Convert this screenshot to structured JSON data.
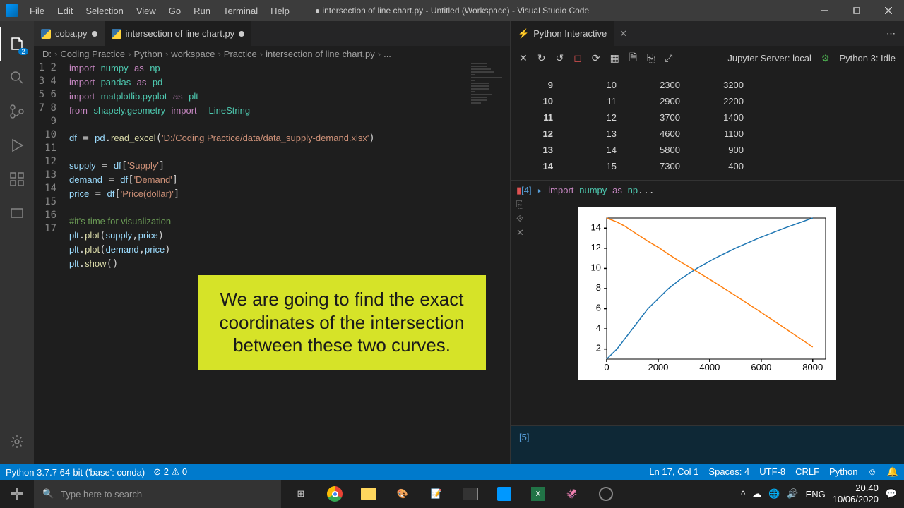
{
  "window": {
    "title": "● intersection of line chart.py - Untitled (Workspace) - Visual Studio Code"
  },
  "menu": [
    "File",
    "Edit",
    "Selection",
    "View",
    "Go",
    "Run",
    "Terminal",
    "Help"
  ],
  "activitybar": {
    "badge": "2"
  },
  "tabs": [
    {
      "label": "coba.py",
      "modified": true
    },
    {
      "label": "intersection of line chart.py",
      "modified": true,
      "active": true
    }
  ],
  "breadcrumb": [
    "D:",
    "Coding Practice",
    "Python",
    "workspace",
    "Practice",
    "intersection of line chart.py",
    "..."
  ],
  "code_lines": [
    "import numpy as np",
    "import pandas as pd",
    "import matplotlib.pyplot as plt",
    "from shapely.geometry import  LineString",
    "",
    "df = pd.read_excel('D:/Coding Practice/data/data_supply-demand.xlsx')",
    "",
    "supply = df['Supply']",
    "demand = df['Demand']",
    "price = df['Price(dollar)']",
    "",
    "#it's time for visualization",
    "plt.plot(supply,price)",
    "plt.plot(demand,price)",
    "plt.show()",
    "",
    ""
  ],
  "annotation": "We are going to find the exact coordinates of the intersection between these two curves.",
  "interactive": {
    "tab_label": "Python Interactive",
    "server_label": "Jupyter Server: local",
    "kernel_label": "Python 3: Idle",
    "data_rows": [
      {
        "idx": "9",
        "c1": "10",
        "c2": "2300",
        "c3": "3200"
      },
      {
        "idx": "10",
        "c1": "11",
        "c2": "2900",
        "c3": "2200"
      },
      {
        "idx": "11",
        "c1": "12",
        "c2": "3700",
        "c3": "1400"
      },
      {
        "idx": "12",
        "c1": "13",
        "c2": "4600",
        "c3": "1100"
      },
      {
        "idx": "13",
        "c1": "14",
        "c2": "5800",
        "c3": "900"
      },
      {
        "idx": "14",
        "c1": "15",
        "c2": "7300",
        "c3": "400"
      }
    ],
    "cell4_prompt": "[4]",
    "cell4_code": "import numpy as np...",
    "cell5_prompt": "[5]"
  },
  "chart_data": {
    "type": "line",
    "x": [
      0,
      400,
      700,
      1000,
      1300,
      1600,
      2000,
      2400,
      2900,
      3500,
      4200,
      5000,
      5900,
      6900,
      8000
    ],
    "series": [
      {
        "name": "supply",
        "color": "#1f77b4",
        "values": [
          1,
          2,
          3,
          4,
          5,
          6,
          7,
          8,
          9,
          10,
          11,
          12,
          13,
          14,
          15
        ]
      },
      {
        "name": "demand",
        "color": "#ff7f0e",
        "values": [
          15,
          14.6,
          14.2,
          13.7,
          13.2,
          12.7,
          12.1,
          11.4,
          10.6,
          9.7,
          8.6,
          7.3,
          5.8,
          4.1,
          2.2
        ]
      }
    ],
    "xlim": [
      0,
      8500
    ],
    "ylim": [
      1,
      15
    ],
    "xticks": [
      0,
      2000,
      4000,
      6000,
      8000
    ],
    "yticks": [
      2,
      4,
      6,
      8,
      10,
      12,
      14
    ]
  },
  "statusbar": {
    "python": "Python 3.7.7 64-bit ('base': conda)",
    "problems_err": "2",
    "problems_warn": "0",
    "cursor": "Ln 17, Col 1",
    "spaces": "Spaces: 4",
    "encoding": "UTF-8",
    "eol": "CRLF",
    "lang": "Python"
  },
  "taskbar": {
    "search_placeholder": "Type here to search",
    "time": "20.40",
    "date": "10/06/2020"
  }
}
